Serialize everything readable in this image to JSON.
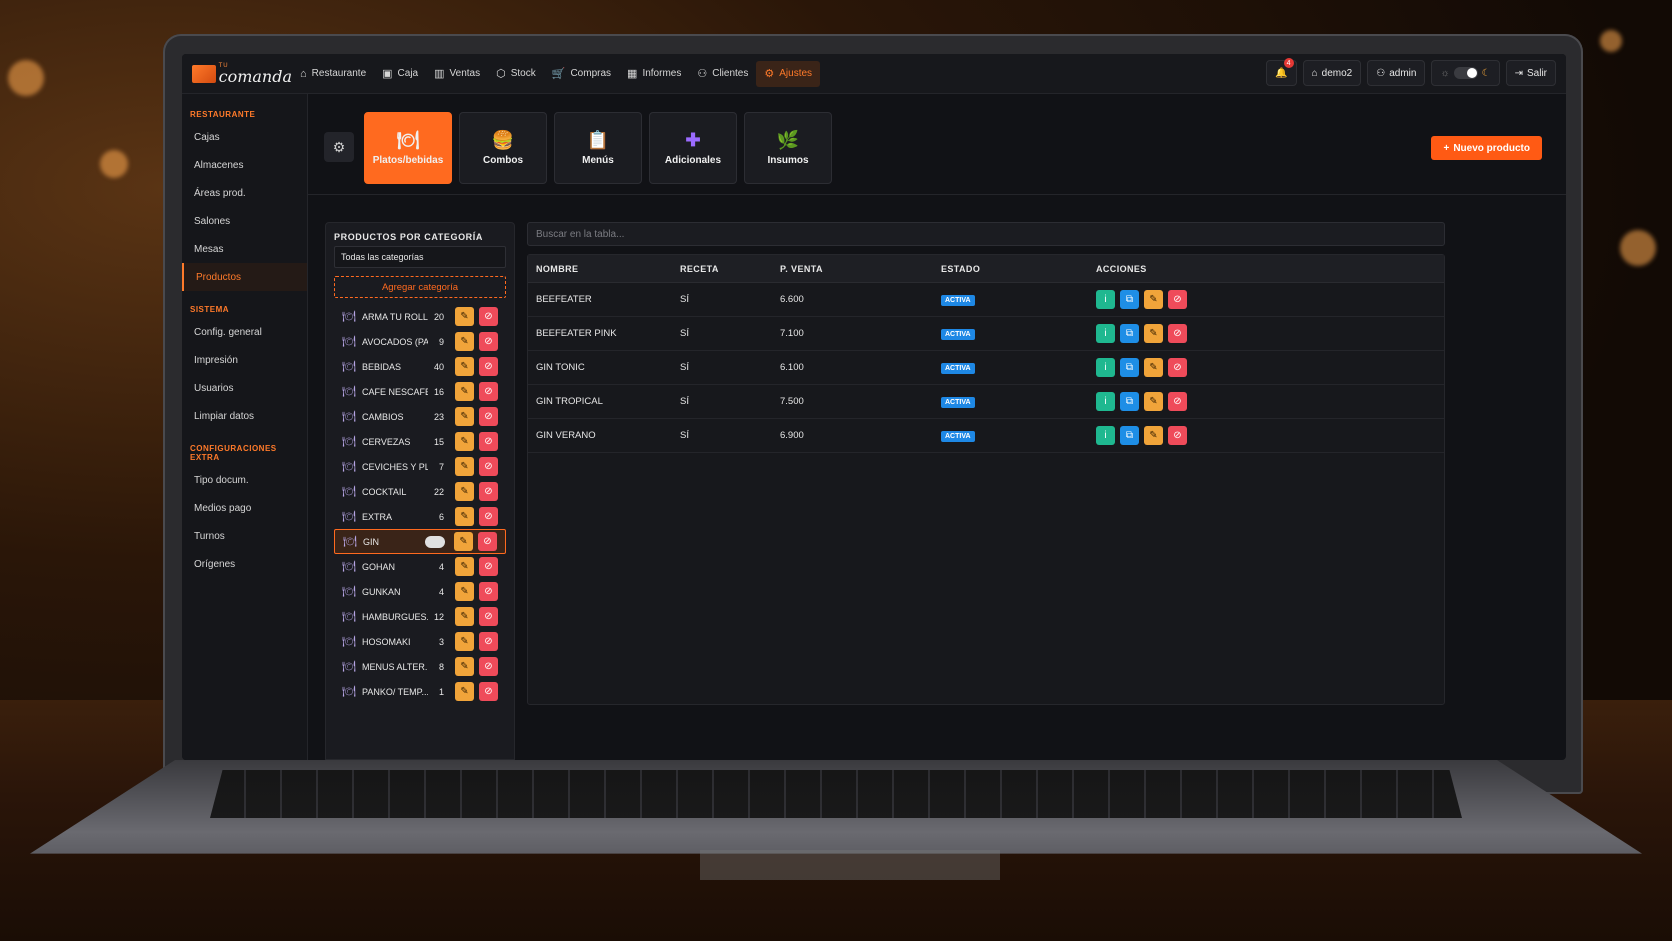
{
  "app": {
    "logo_small": "TU",
    "logo_big": "comanda"
  },
  "nav": {
    "items": [
      {
        "label": "Restaurante",
        "icon": "store-icon"
      },
      {
        "label": "Caja",
        "icon": "cash-register-icon"
      },
      {
        "label": "Ventas",
        "icon": "bar-chart-icon"
      },
      {
        "label": "Stock",
        "icon": "box-icon"
      },
      {
        "label": "Compras",
        "icon": "cart-icon"
      },
      {
        "label": "Informes",
        "icon": "report-icon"
      },
      {
        "label": "Clientes",
        "icon": "users-icon"
      },
      {
        "label": "Ajustes",
        "icon": "gear-icon"
      }
    ],
    "active": "Ajustes",
    "notifications_count": "4",
    "tenant": "demo2",
    "user": "admin",
    "logout": "Salir"
  },
  "sidebar": {
    "sections": [
      {
        "title": "RESTAURANTE",
        "items": [
          "Cajas",
          "Almacenes",
          "Áreas prod.",
          "Salones",
          "Mesas",
          "Productos"
        ]
      },
      {
        "title": "SISTEMA",
        "items": [
          "Config. general",
          "Impresión",
          "Usuarios",
          "Limpiar datos"
        ]
      },
      {
        "title": "CONFIGURACIONES EXTRA",
        "items": [
          "Tipo docum.",
          "Medios pago",
          "Turnos",
          "Orígenes"
        ]
      }
    ],
    "active": "Productos"
  },
  "product_types": [
    {
      "label": "Platos/bebidas",
      "icon": "🍽"
    },
    {
      "label": "Combos",
      "icon": "🍔"
    },
    {
      "label": "Menús",
      "icon": "📋"
    },
    {
      "label": "Adicionales",
      "icon": "✚"
    },
    {
      "label": "Insumos",
      "icon": "🌿"
    }
  ],
  "active_type": "Platos/bebidas",
  "new_product_label": "Nuevo producto",
  "categories_panel": {
    "title": "PRODUCTOS POR CATEGORÍA",
    "filter": "Todas las categorías",
    "add_label": "Agregar categoría",
    "items": [
      {
        "name": "ARMA TU ROLL",
        "count": "20"
      },
      {
        "name": "AVOCADOS (PA...",
        "count": "9"
      },
      {
        "name": "BEBIDAS",
        "count": "40"
      },
      {
        "name": "CAFE NESCAFE",
        "count": "16"
      },
      {
        "name": "CAMBIOS",
        "count": "23"
      },
      {
        "name": "CERVEZAS",
        "count": "15"
      },
      {
        "name": "CEVICHES Y PL...",
        "count": "7"
      },
      {
        "name": "COCKTAIL",
        "count": "22"
      },
      {
        "name": "EXTRA",
        "count": "6"
      },
      {
        "name": "GIN",
        "count": ""
      },
      {
        "name": "GOHAN",
        "count": "4"
      },
      {
        "name": "GUNKAN",
        "count": "4"
      },
      {
        "name": "HAMBURGUES...",
        "count": "12"
      },
      {
        "name": "HOSOMAKI",
        "count": "3"
      },
      {
        "name": "MENUS ALTER...",
        "count": "8"
      },
      {
        "name": "PANKO/ TEMP...",
        "count": "1"
      }
    ],
    "selected": "GIN"
  },
  "products_table": {
    "search_placeholder": "Buscar en la tabla...",
    "columns": [
      "NOMBRE",
      "RECETA",
      "P. VENTA",
      "ESTADO",
      "ACCIONES"
    ],
    "rows": [
      {
        "nombre": "BEEFEATER",
        "receta": "SÍ",
        "precio": "6.600",
        "estado": "ACTIVA"
      },
      {
        "nombre": "BEEFEATER PINK",
        "receta": "SÍ",
        "precio": "7.100",
        "estado": "ACTIVA"
      },
      {
        "nombre": "GIN TONIC",
        "receta": "SÍ",
        "precio": "6.100",
        "estado": "ACTIVA"
      },
      {
        "nombre": "GIN TROPICAL",
        "receta": "SÍ",
        "precio": "7.500",
        "estado": "ACTIVA"
      },
      {
        "nombre": "GIN VERANO",
        "receta": "SÍ",
        "precio": "6.900",
        "estado": "ACTIVA"
      }
    ]
  },
  "colors": {
    "accent": "#ff6a1f",
    "status": "#1e88e5",
    "edit": "#f0a43a",
    "delete": "#ef4b5a",
    "info": "#1fb890",
    "copy": "#1e8ee6"
  }
}
